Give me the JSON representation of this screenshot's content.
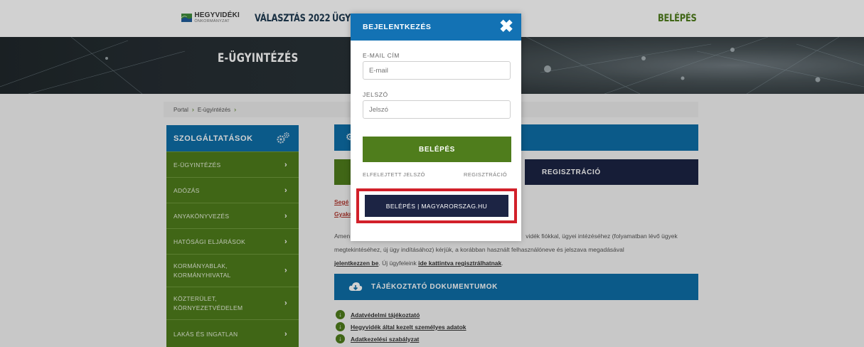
{
  "nav": {
    "logo_line1": "HEGYVIDÉKI",
    "logo_line2": "ÖNKORMÁNYZAT",
    "items": [
      "VÁLASZTÁS 2022",
      "ÜGYI"
    ],
    "login": "BELÉPÉS"
  },
  "banner": {
    "title": "E-ÜGYINTÉZÉS"
  },
  "breadcrumb": {
    "items": [
      "Portal",
      "E-ügyintézés"
    ]
  },
  "sidebar": {
    "title": "SZOLGÁLTATÁSOK",
    "items": [
      {
        "label": "E-ÜGYINTÉZÉS"
      },
      {
        "label": "ADÓZÁS"
      },
      {
        "label": "ANYAKÖNYVEZÉS"
      },
      {
        "label": "HATÓSÁGI ELJÁRÁSOK"
      },
      {
        "label_1": "KORMÁNYABLAK,",
        "label_2": "KORMÁNYHIVATAL"
      },
      {
        "label_1": "KÖZTERÜLET,",
        "label_2": "KÖRNYEZETVÉDELEM"
      },
      {
        "label": "LAKÁS ÉS INGATLAN"
      }
    ]
  },
  "main": {
    "register_button": "REGISZTRÁCIÓ",
    "links": [
      "Segé",
      "Gyakr"
    ],
    "para": {
      "line1_start": "Amen",
      "line1_end": "vidék fiókkal, ügyei intézéséhez (folyamatban lévő ügyek",
      "line2": "megtekintéséhez, új ügy indításához) kérjük, a korábban használt felhasználóneve és jelszava megadásával",
      "line3_link1": "jelentkezzen be",
      "line3_mid": ". Új ügyfeleink ",
      "line3_link2": "ide kattintva regisztrálhatnak",
      "line3_end": "."
    },
    "docs_title": "TÁJÉKOZTATÓ DOKUMENTUMOK",
    "docs": [
      "Adatvédelmi tájékoztató",
      "Hegyvidék által kezelt személyes adatok",
      "Adatkezelési szabályzat"
    ]
  },
  "modal": {
    "title": "BEJELENTKEZÉS",
    "email_label": "E-MAIL CÍM",
    "email_placeholder": "E-mail",
    "password_label": "JELSZÓ",
    "password_placeholder": "Jelszó",
    "login_button": "BELÉPÉS",
    "forgot_link": "ELFELEJTETT JELSZÓ",
    "register_link": "REGISZTRÁCIÓ",
    "mag_button": "BELÉPÉS | MAGYARORSZAG.HU"
  },
  "colors": {
    "blue": "#0e6ea8",
    "green": "#4f7d1c",
    "navy": "#1c2444",
    "highlight_red": "#d2202a"
  }
}
